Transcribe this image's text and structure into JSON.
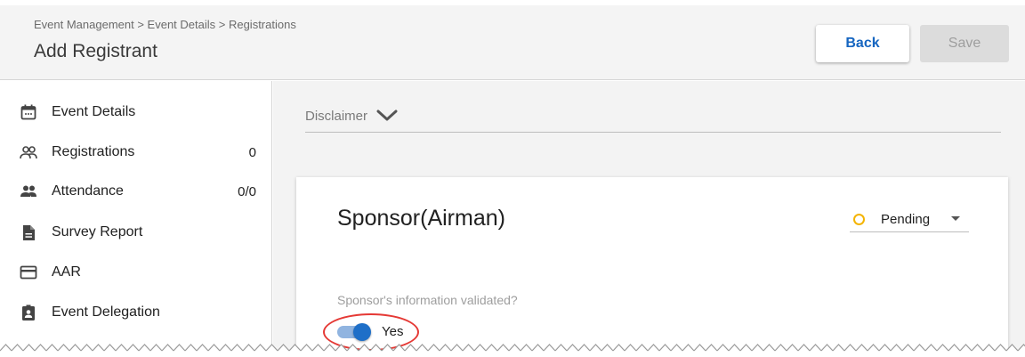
{
  "header": {
    "breadcrumb": "Event Management > Event Details > Registrations",
    "title": "Add Registrant",
    "back_label": "Back",
    "save_label": "Save"
  },
  "sidebar": {
    "items": [
      {
        "label": "Event Details",
        "icon": "calendar-icon",
        "count": ""
      },
      {
        "label": "Registrations",
        "icon": "people-outline-icon",
        "count": "0"
      },
      {
        "label": "Attendance",
        "icon": "people-filled-icon",
        "count": "0/0"
      },
      {
        "label": "Survey Report",
        "icon": "document-icon",
        "count": ""
      },
      {
        "label": "AAR",
        "icon": "card-icon",
        "count": ""
      },
      {
        "label": "Event Delegation",
        "icon": "badge-icon",
        "count": ""
      }
    ]
  },
  "main": {
    "disclaimer_label": "Disclaimer",
    "card": {
      "title": "Sponsor(Airman)",
      "status": "Pending",
      "validated_question": "Sponsor's information validated?",
      "toggle_label": "Yes",
      "toggle_on": true
    }
  },
  "colors": {
    "accent": "#1565c0",
    "status_pending": "#f4b400",
    "highlight_ring": "#e53935",
    "toggle_thumb": "#1e6fc8",
    "toggle_track": "#90b4e0"
  }
}
